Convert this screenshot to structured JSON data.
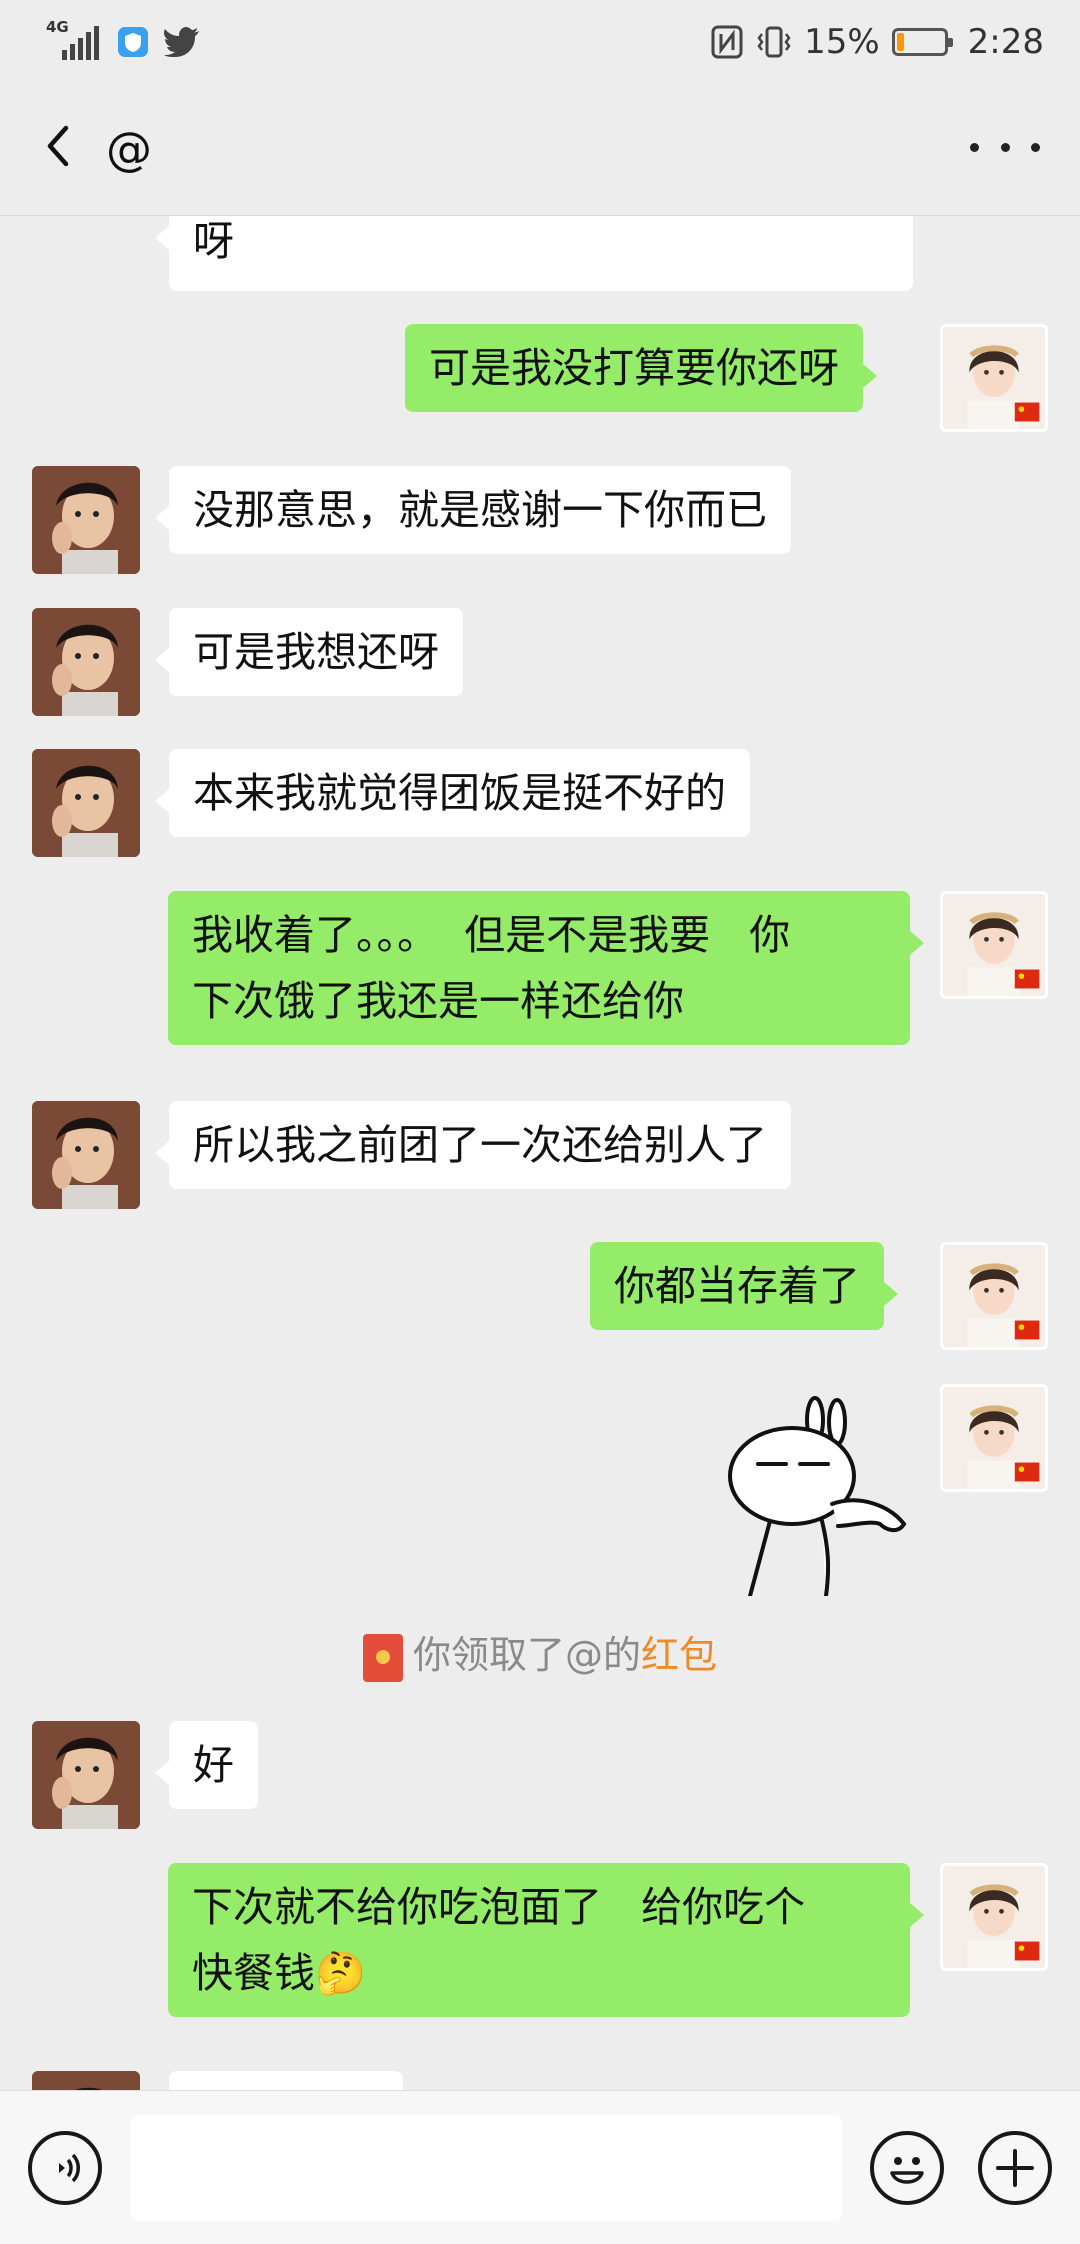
{
  "status": {
    "network": "4G",
    "battery": "15%",
    "time": "2:28"
  },
  "header": {
    "title": "@"
  },
  "messages": [
    {
      "side": "in",
      "lines": [
        "呀"
      ]
    },
    {
      "side": "out",
      "lines": [
        "可是我没打算要你还呀"
      ]
    },
    {
      "side": "in",
      "lines": [
        "没那意思，就是感谢一下你而已"
      ]
    },
    {
      "side": "in",
      "lines": [
        "可是我想还呀"
      ]
    },
    {
      "side": "in",
      "lines": [
        "本来我就觉得团饭是挺不好的"
      ]
    },
    {
      "side": "out",
      "lines": [
        "我收着了。。。  但是不是我要   你",
        "下次饿了我还是一样还给你"
      ]
    },
    {
      "side": "in",
      "lines": [
        "所以我之前团了一次还给别人了"
      ]
    },
    {
      "side": "out",
      "lines": [
        "你都当存着了"
      ]
    },
    {
      "side": "in",
      "lines": [
        "好"
      ]
    },
    {
      "side": "out",
      "lines": [
        "下次就不给你吃泡面了   给你吃个",
        "快餐钱🤔"
      ]
    }
  ],
  "system_notice": {
    "prefix": "你领取了@的",
    "link": "红包"
  },
  "input": {
    "placeholder": ""
  }
}
